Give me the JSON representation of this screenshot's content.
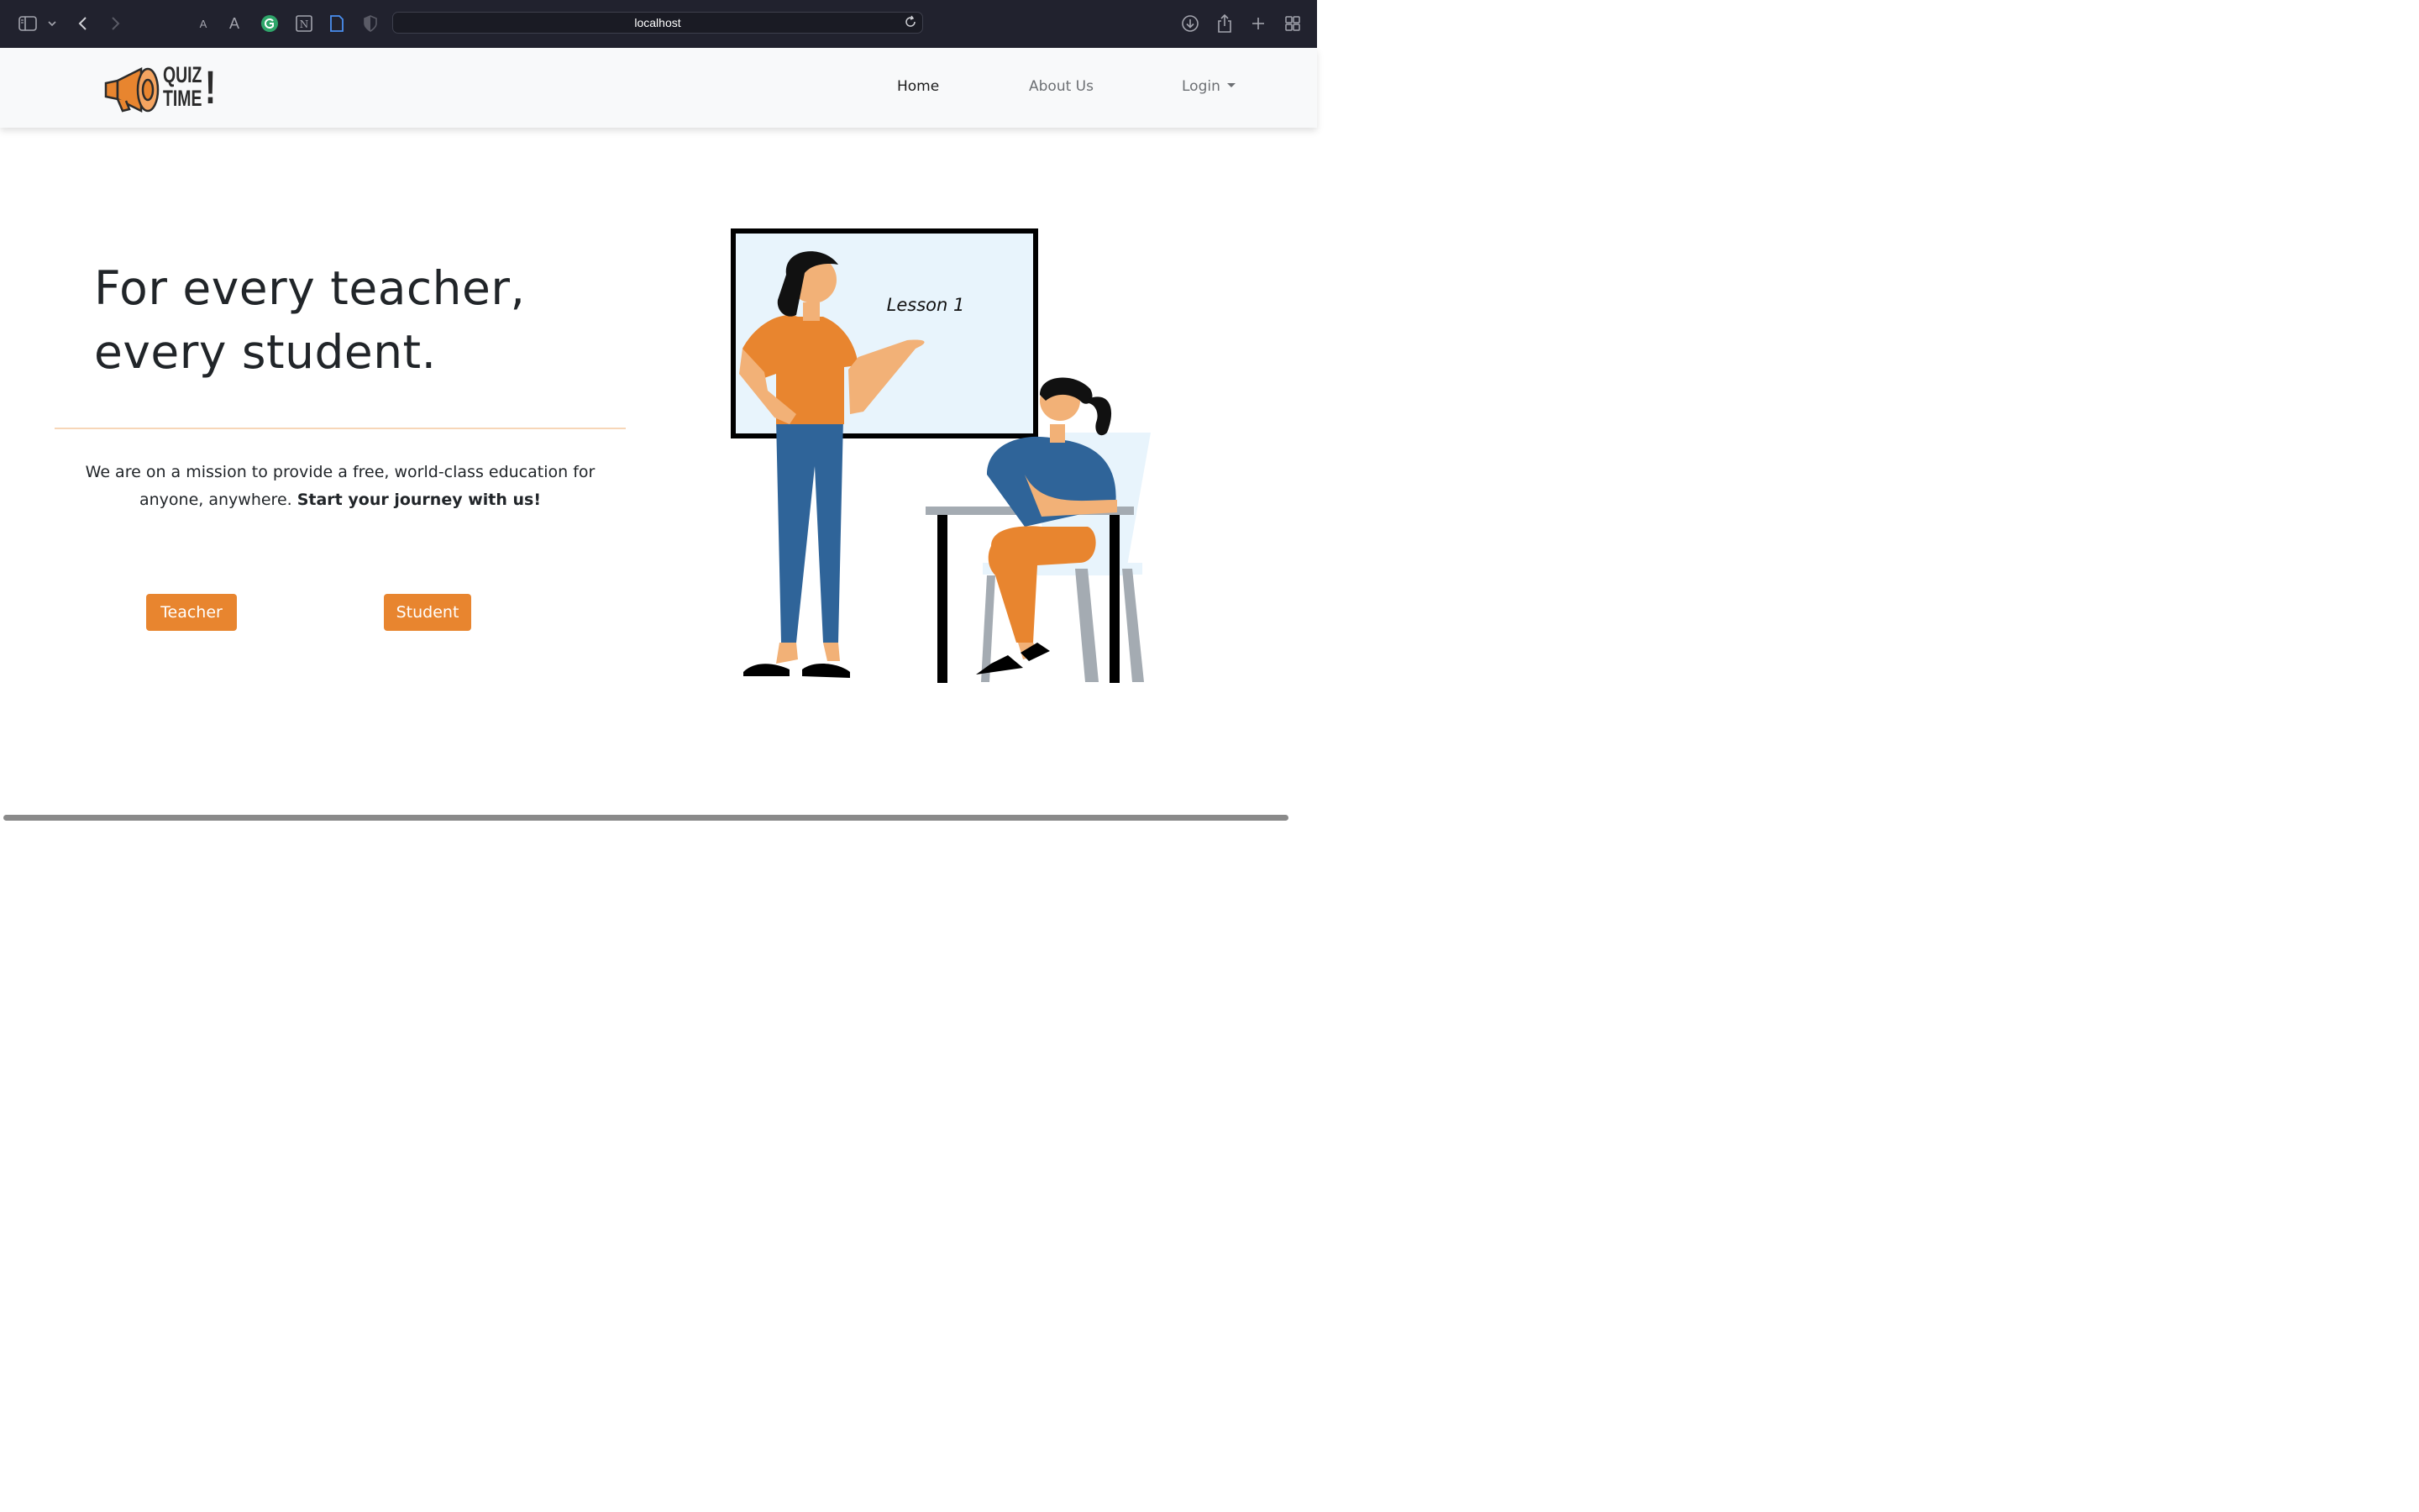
{
  "browser": {
    "url": "localhost",
    "font_small_label": "A",
    "font_large_label": "A",
    "toolbar_icons": [
      "sidebar-icon",
      "chevron-down-icon",
      "back-icon",
      "forward-icon",
      "grammarly-icon",
      "notion-icon",
      "document-icon",
      "privacy-shield-icon",
      "reload-icon",
      "download-icon",
      "share-icon",
      "new-tab-icon",
      "tab-overview-icon"
    ]
  },
  "navbar": {
    "logo_line1": "QUIZ",
    "logo_line2": "TIME",
    "logo_mark": "!",
    "links": [
      {
        "label": "Home",
        "active": true
      },
      {
        "label": "About Us",
        "active": false
      },
      {
        "label": "Login",
        "active": false,
        "dropdown": true
      }
    ]
  },
  "hero": {
    "title_line1": "For every teacher,",
    "title_line2": "every student.",
    "mission_text": "We are on a mission to provide a free, world-class education for anyone, anywhere.",
    "mission_cta": "Start your journey with us!",
    "buttons": {
      "teacher": "Teacher",
      "student": "Student"
    },
    "illustration_board_text": "Lesson 1"
  },
  "colors": {
    "accent": "#e8852f",
    "navbar_bg": "#f8f9fa",
    "chrome_bg": "#21222e",
    "shirt_blue": "#2f6499",
    "board_bg": "#e8f4fc"
  }
}
